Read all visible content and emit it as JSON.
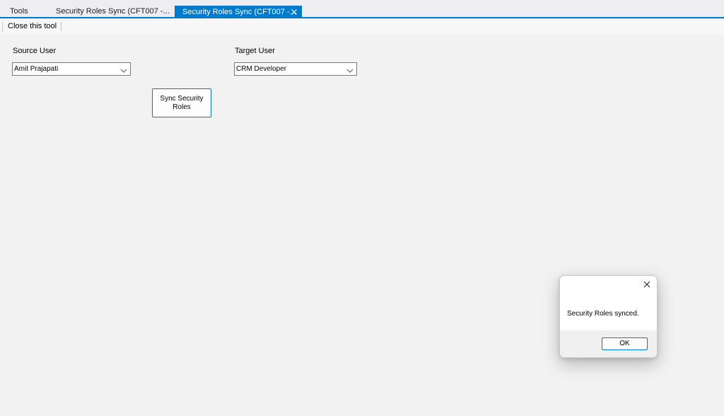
{
  "tabs": {
    "tools_label": "Tools",
    "tab1_label": "Security Roles Sync (CFT007 -...",
    "tab2_label": "Security Roles Sync (CFT007 -...",
    "active_tab": 2
  },
  "toolbar": {
    "close_label": "Close this tool"
  },
  "form": {
    "source_label": "Source User",
    "source_value": "Amit Prajapati",
    "target_label": "Target User",
    "target_value": "CRM Developer",
    "sync_button_label": "Sync Security Roles"
  },
  "dialog": {
    "message": "Security Roles synced.",
    "ok_label": "OK"
  },
  "colors": {
    "accent": "#007acc",
    "background": "#f2f2f2"
  },
  "icons": {
    "tab_close": "close-icon",
    "dropdown": "chevron-down-icon",
    "dialog_close": "close-icon"
  }
}
